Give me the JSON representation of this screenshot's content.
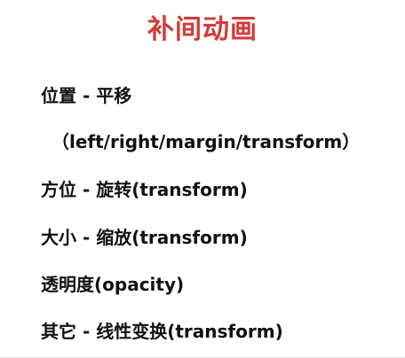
{
  "title": "补间动画",
  "title_color": "#d33a3a",
  "items": [
    "位置 - 平移",
    "（left/right/margin/transform）",
    "方位 - 旋转(transform)",
    "大小 - 缩放(transform)",
    "透明度(opacity)",
    "其它 - 线性变换(transform)"
  ]
}
